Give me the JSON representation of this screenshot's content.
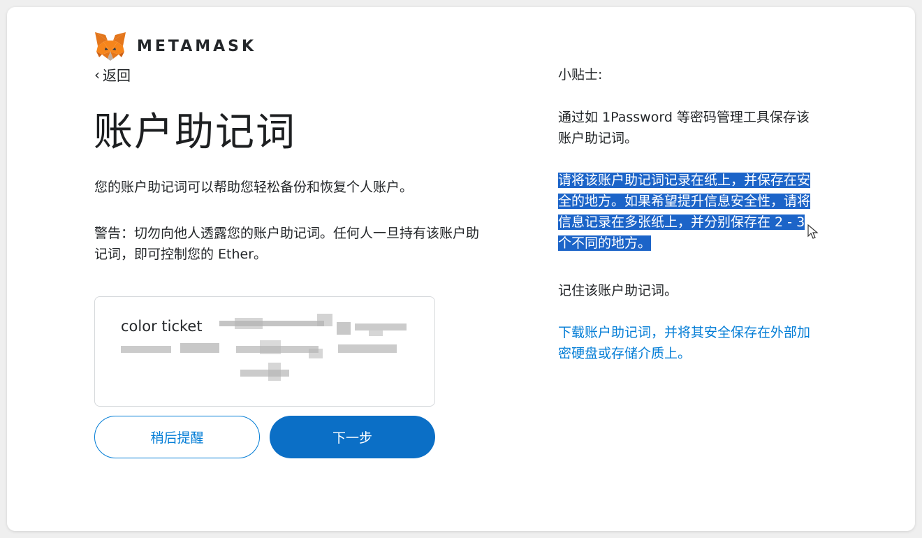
{
  "brand": {
    "name": "METAMASK"
  },
  "nav": {
    "back_label": "返回"
  },
  "page": {
    "title": "账户助记词",
    "description": "您的账户助记词可以帮助您轻松备份和恢复个人账户。",
    "warning": "警告：切勿向他人透露您的账户助记词。任何人一旦持有该账户助记词，即可控制您的 Ether。"
  },
  "phrase": {
    "visible_text": "color ticket"
  },
  "buttons": {
    "remind_later": "稍后提醒",
    "next": "下一步"
  },
  "tips": {
    "heading": "小贴士:",
    "tip1": "通过如 1Password 等密码管理工具保存该账户助记词。",
    "tip2": "请将该账户助记词记录在纸上，并保存在安全的地方。如果希望提升信息安全性，请将信息记录在多张纸上，并分别保存在 2 - 3 个不同的地方。",
    "tip3": "记住该账户助记词。",
    "download_link": "下载账户助记词，并将其安全保存在外部加密硬盘或存储介质上。"
  },
  "colors": {
    "primary": "#0b6fc6",
    "link": "#037dd6",
    "highlight": "#1c64c8",
    "text": "#24272a",
    "fox_orange": "#e2761b"
  },
  "icons": {
    "logo": "metamask-fox-icon",
    "back": "chevron-left-icon",
    "cursor": "mouse-pointer-icon"
  }
}
